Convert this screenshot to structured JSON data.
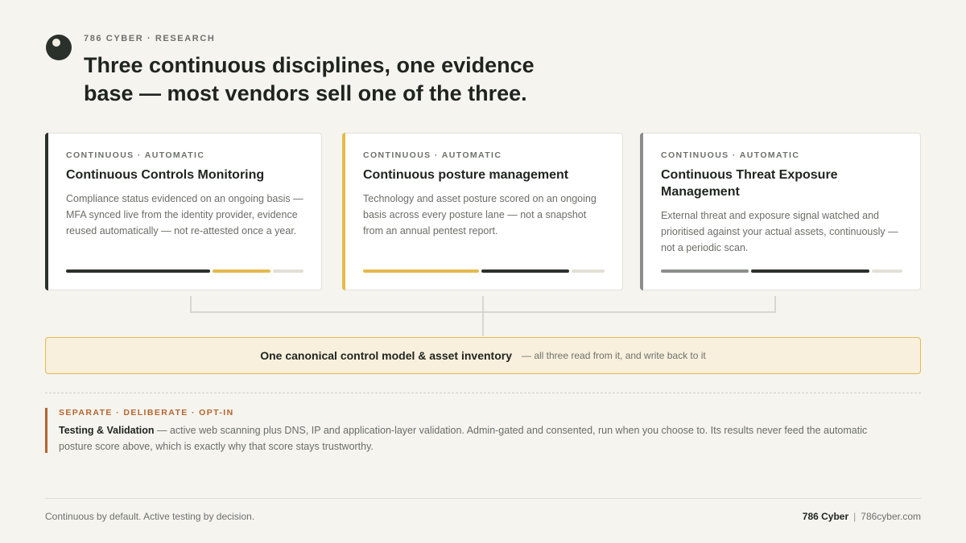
{
  "brand": {
    "eyebrow": "786 CYBER · RESEARCH",
    "name": "786 Cyber",
    "url": "786cyber.com"
  },
  "headline": "Three continuous disciplines, one evidence base — most vendors sell one of the three.",
  "colors": {
    "dark": "#2a302a",
    "gold": "#e5b94d",
    "gray": "#8a8e8a",
    "light": "#e2dfd6",
    "rust": "#b5652f"
  },
  "cards": [
    {
      "tag": "CONTINUOUS · AUTOMATIC",
      "title": "Continuous Controls Monitoring",
      "body": "Compliance status evidenced on an ongoing basis — MFA synced live from the identity provider, evidence reused automatically — not re-attested once a year.",
      "accent": "dark",
      "segments": [
        {
          "share": 0.62,
          "color": "dark"
        },
        {
          "share": 0.25,
          "color": "gold"
        },
        {
          "share": 0.13,
          "color": "light"
        }
      ]
    },
    {
      "tag": "CONTINUOUS · AUTOMATIC",
      "title": "Continuous posture management",
      "body": "Technology and asset posture scored on an ongoing basis across every posture lane — not a snapshot from an annual pentest report.",
      "accent": "gold",
      "segments": [
        {
          "share": 0.49,
          "color": "gold"
        },
        {
          "share": 0.37,
          "color": "dark"
        },
        {
          "share": 0.14,
          "color": "light"
        }
      ]
    },
    {
      "tag": "CONTINUOUS · AUTOMATIC",
      "title": "Continuous Threat Exposure Management",
      "body": "External threat and exposure signal watched and prioritised against your actual assets, continuously — not a periodic scan.",
      "accent": "gray",
      "segments": [
        {
          "share": 0.37,
          "color": "gray"
        },
        {
          "share": 0.5,
          "color": "dark"
        },
        {
          "share": 0.13,
          "color": "light"
        }
      ]
    }
  ],
  "base": {
    "title": "One canonical control model & asset inventory",
    "subtitle": "— all three read from it, and write back to it"
  },
  "separate": {
    "tag": "SEPARATE · DELIBERATE · OPT-IN",
    "title": "Testing & Validation",
    "body": " — active web scanning plus DNS, IP and application-layer validation. Admin-gated and consented, run when you choose to. Its results never feed the automatic posture score above, which is exactly why that score stays trustworthy."
  },
  "footer": {
    "tagline": "Continuous by default. Active testing by decision."
  }
}
